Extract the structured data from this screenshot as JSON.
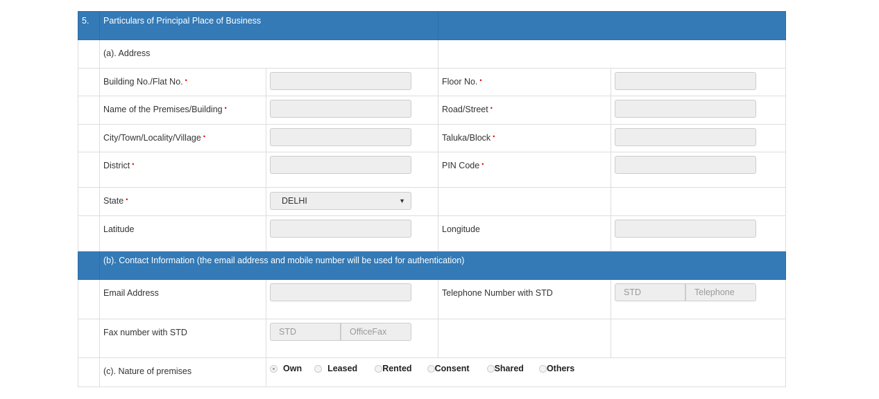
{
  "section": {
    "number": "5.",
    "title": "Particulars of Principal Place of Business"
  },
  "address": {
    "heading": "(a). Address",
    "building": "Building No./Flat No.",
    "floor": "Floor No.",
    "premises": "Name of the Premises/Building",
    "road": "Road/Street",
    "city": "City/Town/Locality/Village",
    "taluka": "Taluka/Block",
    "district": "District",
    "pin": "PIN Code",
    "state": "State",
    "state_value": "DELHI",
    "latitude": "Latitude",
    "longitude": "Longitude",
    "required_mark": "•"
  },
  "contact": {
    "heading": "(b). Contact Information (the email address and mobile number will be used for authentication)",
    "email": "Email Address",
    "telephone": "Telephone Number with STD",
    "tel_std_placeholder": "STD",
    "tel_placeholder": "Telephone",
    "fax": "Fax number with STD",
    "fax_std_placeholder": "STD",
    "fax_placeholder": "OfficeFax"
  },
  "premises_nature": {
    "label": "(c). Nature of premises",
    "selected": "Own",
    "options": [
      "Own",
      "Leased",
      "Rented",
      "Consent",
      "Shared",
      "Others"
    ]
  },
  "colors": {
    "header": "#337ab7",
    "required": "#dd0000"
  }
}
